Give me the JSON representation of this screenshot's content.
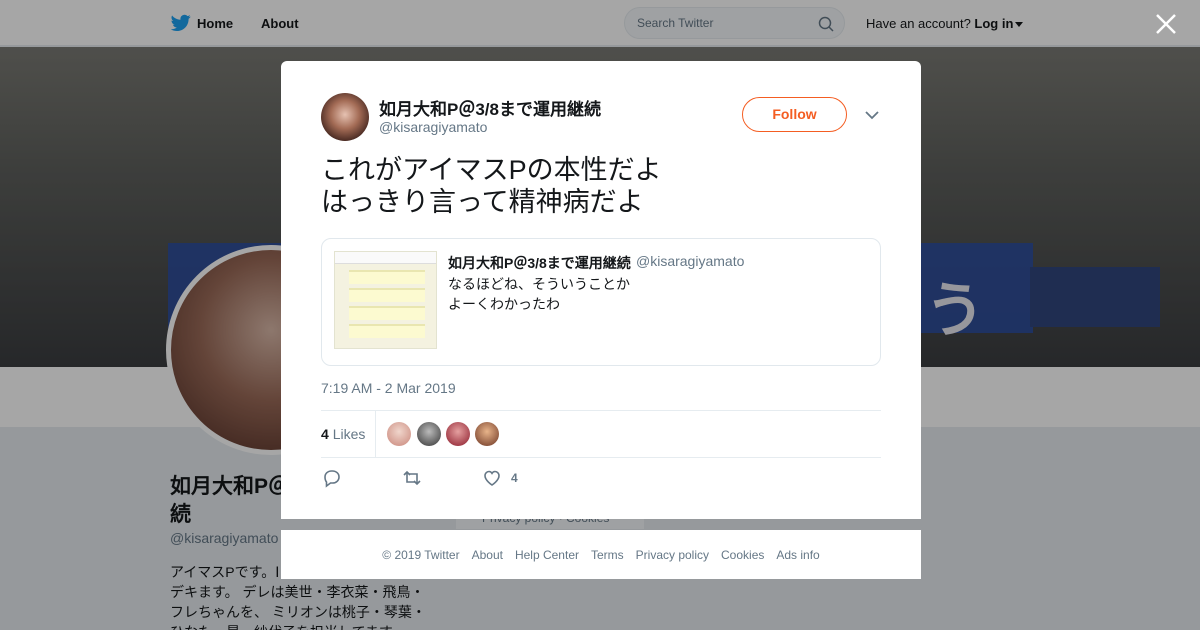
{
  "nav": {
    "home": "Home",
    "about": "About",
    "search_placeholder": "Search Twitter",
    "have_account": "Have an account?",
    "login": "Log in"
  },
  "profile": {
    "name": "如月大和P＠3/8まで運用継続",
    "name_visible": "如月大和P＠",
    "name_line2": "続",
    "handle": "@kisaragiyamato",
    "bio_lines": [
      "アイマスPです。Ⅰ",
      "デキます。 デレは美世・李衣菜・飛鳥・",
      "フレちゃんを、 ミリオンは桃子・琴葉・",
      "ひなた・昴・紗代子を担当してます。"
    ],
    "side_footer": "Privacy policy · Cookies"
  },
  "tweet": {
    "author_name": "如月大和P＠3/8まで運用継続",
    "author_handle": "@kisaragiyamato",
    "follow_label": "Follow",
    "text": "これがアイマスPの本性だよ\nはっきり言って精神病だよ",
    "quote": {
      "name": "如月大和P＠3/8まで運用継続",
      "handle": "@kisaragiyamato",
      "text": "なるほどね、そういうことか\nよーくわかったわ"
    },
    "timestamp": "7:19 AM - 2 Mar 2019",
    "likes_count": "4",
    "likes_label": "Likes",
    "like_action_count": "4"
  },
  "footer": {
    "links": [
      "© 2019 Twitter",
      "About",
      "Help Center",
      "Terms",
      "Privacy policy",
      "Cookies",
      "Ads info"
    ]
  },
  "colors": {
    "accent": "#f45d22",
    "twitter_blue": "#1da1f2",
    "muted": "#657786"
  }
}
